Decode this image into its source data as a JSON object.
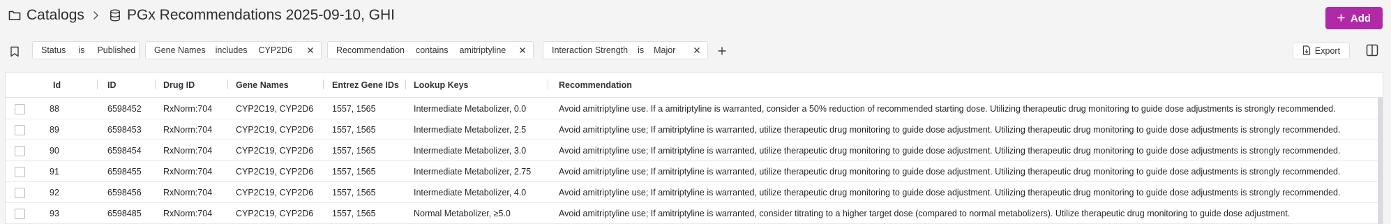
{
  "breadcrumb": {
    "root": "Catalogs",
    "current": "PGx Recommendations 2025-09-10, GHI"
  },
  "actions": {
    "add_label": "Add",
    "export_label": "Export"
  },
  "filters": [
    {
      "field": "Status",
      "op": "is",
      "value": "Published",
      "removable": false
    },
    {
      "field": "Gene Names",
      "op": "includes",
      "value": "CYP2D6",
      "removable": true
    },
    {
      "field": "Recommendation",
      "op": "contains",
      "value": "amitriptyline",
      "removable": true
    },
    {
      "field": "Interaction Strength",
      "op": "is",
      "value": "Major",
      "removable": true
    }
  ],
  "table": {
    "columns": [
      "Id",
      "ID",
      "Drug ID",
      "Gene Names",
      "Entrez Gene IDs",
      "Lookup Keys",
      "Recommendation"
    ],
    "rows": [
      [
        "88",
        "6598452",
        "RxNorm:704",
        "CYP2C19, CYP2D6",
        "1557, 1565",
        "Intermediate Metabolizer, 0.0",
        "Avoid amitriptyline use. If a amitriptyline is warranted, consider a 50% reduction of recommended starting dose. Utilizing therapeutic drug monitoring to guide dose adjustments is strongly recommended."
      ],
      [
        "89",
        "6598453",
        "RxNorm:704",
        "CYP2C19, CYP2D6",
        "1557, 1565",
        "Intermediate Metabolizer, 2.5",
        "Avoid amitriptyline use; If amitriptyline is warranted, utilize therapeutic drug monitoring to guide dose adjustment. Utilizing therapeutic drug monitoring to guide dose adjustments is strongly recommended."
      ],
      [
        "90",
        "6598454",
        "RxNorm:704",
        "CYP2C19, CYP2D6",
        "1557, 1565",
        "Intermediate Metabolizer, 3.0",
        "Avoid amitriptyline use; If amitriptyline is warranted, utilize therapeutic drug monitoring to guide dose adjustment. Utilizing therapeutic drug monitoring to guide dose adjustments is strongly recommended."
      ],
      [
        "91",
        "6598455",
        "RxNorm:704",
        "CYP2C19, CYP2D6",
        "1557, 1565",
        "Intermediate Metabolizer, 2.75",
        "Avoid amitriptyline use; If amitriptyline is warranted, utilize therapeutic drug monitoring to guide dose adjustment. Utilizing therapeutic drug monitoring to guide dose adjustments is strongly recommended."
      ],
      [
        "92",
        "6598456",
        "RxNorm:704",
        "CYP2C19, CYP2D6",
        "1557, 1565",
        "Intermediate Metabolizer, 4.0",
        "Avoid amitriptyline use; If amitriptyline is warranted, utilize therapeutic drug monitoring to guide dose adjustment. Utilizing therapeutic drug monitoring to guide dose adjustments is strongly recommended."
      ],
      [
        "93",
        "6598485",
        "RxNorm:704",
        "CYP2C19, CYP2D6",
        "1557, 1565",
        "Normal Metabolizer, ≥5.0",
        "Avoid amitriptyline use; If amitriptyline is warranted, consider titrating to a higher target dose (compared to normal metabolizers). Utilize therapeutic drug monitoring to guide dose adjustment."
      ]
    ]
  },
  "icons": {
    "folder": "folder-icon",
    "database": "database-icon",
    "chevron": "chevron-right-icon",
    "bookmark": "bookmark-icon",
    "close": "close-icon",
    "plus": "plus-icon",
    "export": "file-export-icon",
    "columns": "columns-icon"
  },
  "colors": {
    "accent": "#b02aa8",
    "background": "#f4f4f5"
  }
}
